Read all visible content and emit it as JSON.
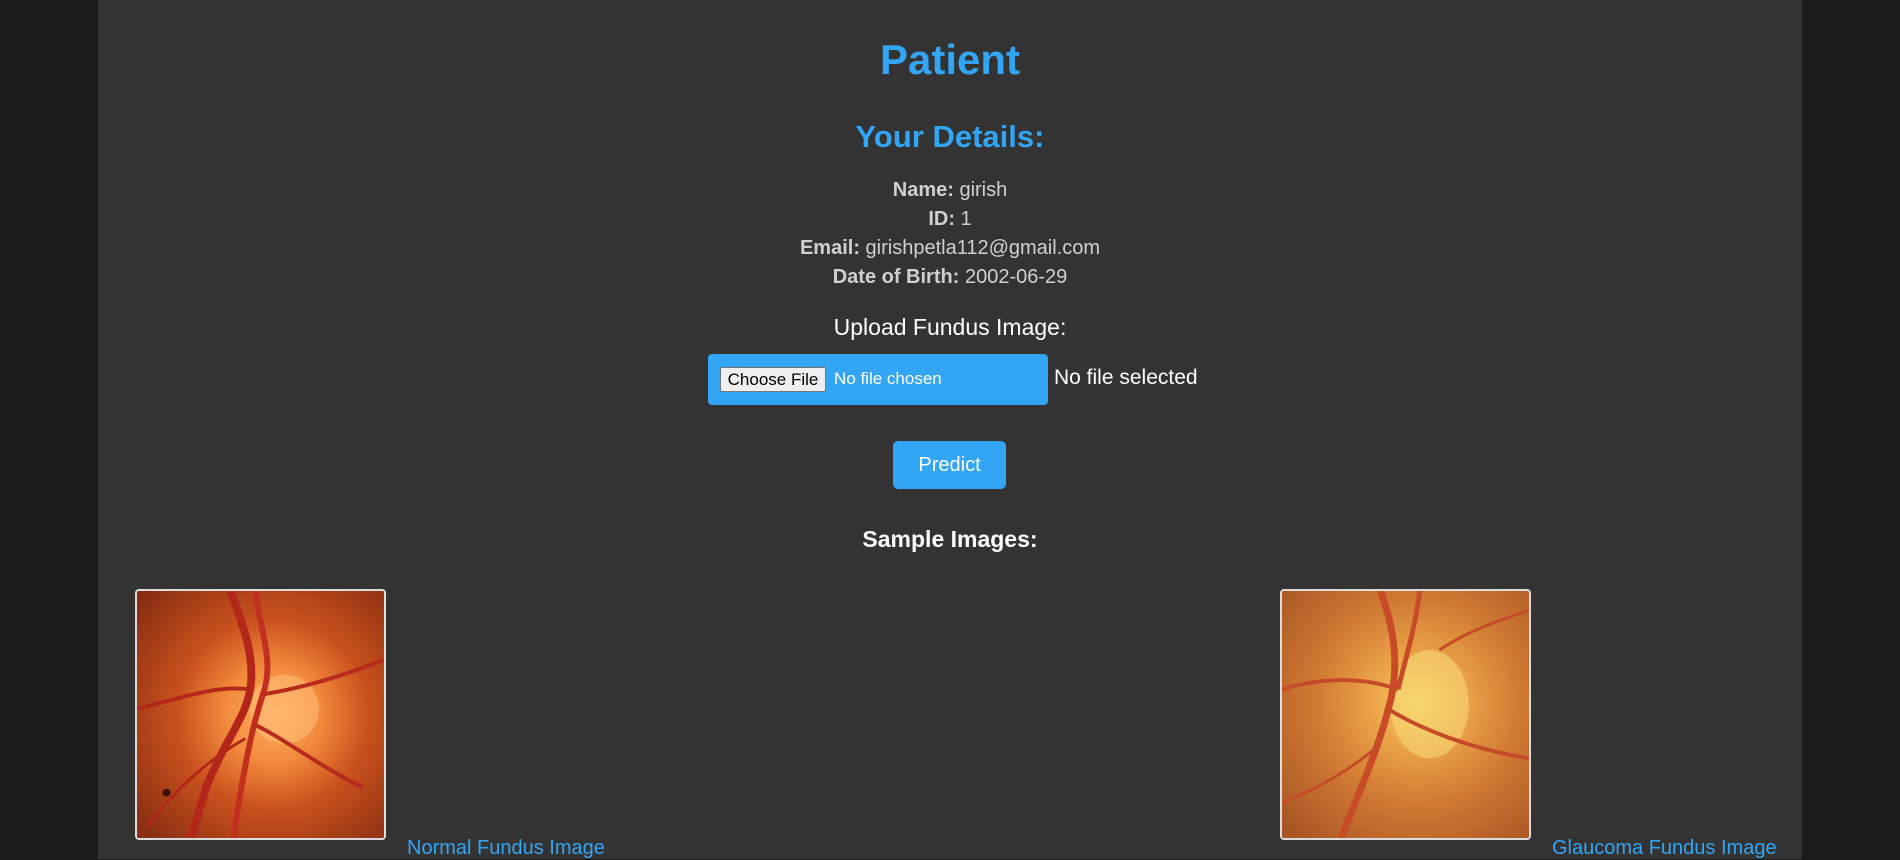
{
  "header": {
    "title": "Patient"
  },
  "details": {
    "heading": "Your Details:",
    "name_label": "Name:",
    "name_value": "girish",
    "id_label": "ID:",
    "id_value": "1",
    "email_label": "Email:",
    "email_value": "girishpetla112@gmail.com",
    "dob_label": "Date of Birth:",
    "dob_value": "2002-06-29"
  },
  "upload": {
    "label": "Upload Fundus Image:",
    "choose_button": "Choose File",
    "file_input_status": "No file chosen",
    "selection_status": "No file selected",
    "predict_button": "Predict"
  },
  "samples": {
    "heading": "Sample Images:",
    "items": [
      {
        "caption": "Normal Fundus Image"
      },
      {
        "caption": "Glaucoma Fundus Image"
      }
    ]
  },
  "colors": {
    "accent": "#33a5f5",
    "panel_background": "#333333",
    "page_background": "#1b1b1b",
    "detail_text": "#d0d0d0"
  }
}
